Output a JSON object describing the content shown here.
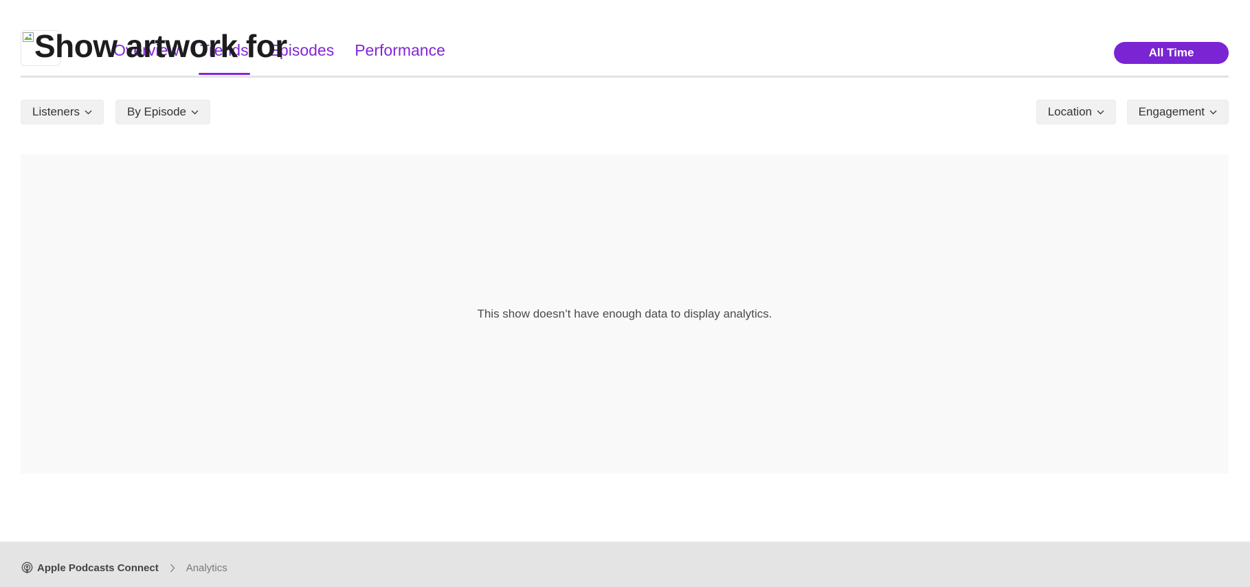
{
  "header": {
    "artwork_alt": "Show artwork for",
    "tabs": [
      {
        "label": "Overview",
        "active": false
      },
      {
        "label": "Trends",
        "active": true
      },
      {
        "label": "Episodes",
        "active": false
      },
      {
        "label": "Performance",
        "active": false
      }
    ],
    "time_range_label": "All Time"
  },
  "filters": {
    "metric": "Listeners",
    "grouping": "By Episode",
    "location": "Location",
    "engagement": "Engagement"
  },
  "chart_panel": {
    "empty_message": "This show doesn’t have enough data to display analytics."
  },
  "footer": {
    "breadcrumb_home": "Apple Podcasts Connect",
    "breadcrumb_current": "Analytics"
  },
  "icons": {
    "dropdown": "chevron-down-icon",
    "breadcrumb_separator": "chevron-right-icon",
    "podcasts": "podcasts-icon",
    "artwork": "broken-image-icon"
  },
  "colors": {
    "accent": "#8226d7",
    "accent_button": "#7a24d4",
    "panel_bg": "#f9f9f9",
    "footer_bg": "#e4e4e4"
  }
}
